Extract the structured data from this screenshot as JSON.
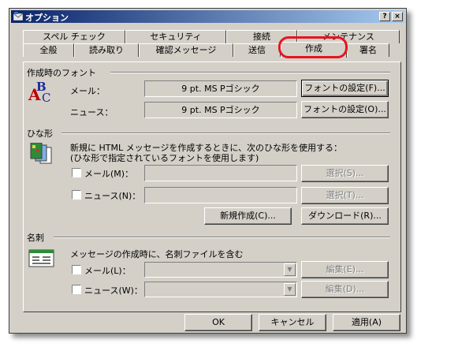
{
  "window": {
    "title": "オプション",
    "help_btn": "?",
    "close_btn": "×"
  },
  "tabs_back": [
    "スペル チェック",
    "セキュリティ",
    "接続",
    "メンテナンス"
  ],
  "tabs_front": [
    "全般",
    "読み取り",
    "確認メッセージ",
    "送信",
    "作成",
    "署名"
  ],
  "font_section": {
    "header": "作成時のフォント",
    "mail_label": "メール：",
    "mail_font": "9 pt. MS Pゴシック",
    "mail_button": "フォントの設定(F)...",
    "news_label": "ニュース：",
    "news_font": "9 pt. MS Pゴシック",
    "news_button": "フォントの設定(O)..."
  },
  "stationery_section": {
    "header": "ひな形",
    "desc1": "新規に HTML メッセージを作成するときに、次のひな形を使用する：",
    "desc2": "(ひな形で指定されているフォントを使用します)",
    "mail_label": "メール(M)：",
    "news_label": "ニュース(N)：",
    "select_s": "選択(S)...",
    "select_t": "選択(T)...",
    "new_button": "新規作成(C)...",
    "download_button": "ダウンロード(R)..."
  },
  "card_section": {
    "header": "名刺",
    "desc": "メッセージの作成時に、名刺ファイルを含む",
    "mail_label": "メール(L)：",
    "news_label": "ニュース(W)：",
    "edit_e": "編集(E)...",
    "edit_d": "編集(D)..."
  },
  "footer": {
    "ok": "OK",
    "cancel": "キャンセル",
    "apply": "適用(A)"
  },
  "colors": {
    "face": "#d4d0c8",
    "title_start": "#0a246a",
    "title_end": "#a6caf0",
    "highlight": "#e4151f"
  }
}
